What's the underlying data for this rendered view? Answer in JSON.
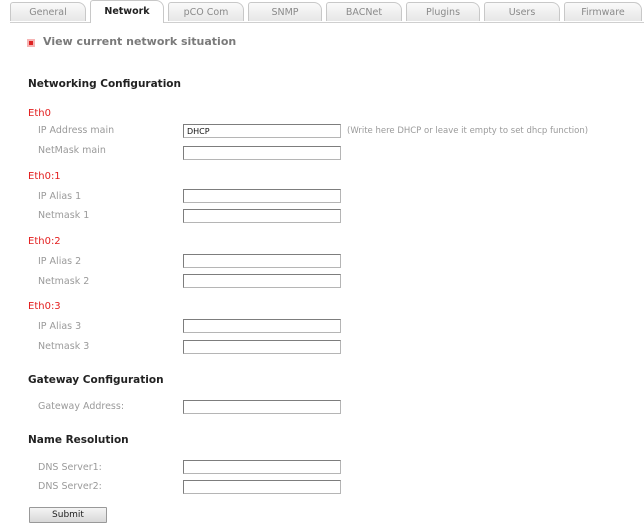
{
  "tabs": [
    "General",
    "Network",
    "pCO Com",
    "SNMP",
    "BACNet",
    "Plugins",
    "Users",
    "Firmware"
  ],
  "active_tab": "Network",
  "view_link": "View current network situation",
  "networking": {
    "title": "Networking Configuration",
    "eth0": {
      "name": "Eth0",
      "ip_label": "IP Address main",
      "ip_value": "DHCP",
      "ip_hint": "(Write here DHCP or leave it empty to set dhcp function)",
      "mask_label": "NetMask main",
      "mask_value": ""
    },
    "eth0_1": {
      "name": "Eth0:1",
      "ip_label": "IP Alias 1",
      "ip_value": "",
      "mask_label": "Netmask 1",
      "mask_value": ""
    },
    "eth0_2": {
      "name": "Eth0:2",
      "ip_label": "IP Alias 2",
      "ip_value": "",
      "mask_label": "Netmask 2",
      "mask_value": ""
    },
    "eth0_3": {
      "name": "Eth0:3",
      "ip_label": "IP Alias 3",
      "ip_value": "",
      "mask_label": "Netmask 3",
      "mask_value": ""
    }
  },
  "gateway": {
    "title": "Gateway Configuration",
    "label": "Gateway Address:",
    "value": ""
  },
  "dns": {
    "title": "Name Resolution",
    "server1_label": "DNS Server1:",
    "server1_value": "",
    "server2_label": "DNS Server2:",
    "server2_value": ""
  },
  "submit_label": "Submit",
  "colors": {
    "interface_heading": "#e31e1e",
    "bullet": "#dd2222",
    "label_text": "#9a9a9a"
  }
}
